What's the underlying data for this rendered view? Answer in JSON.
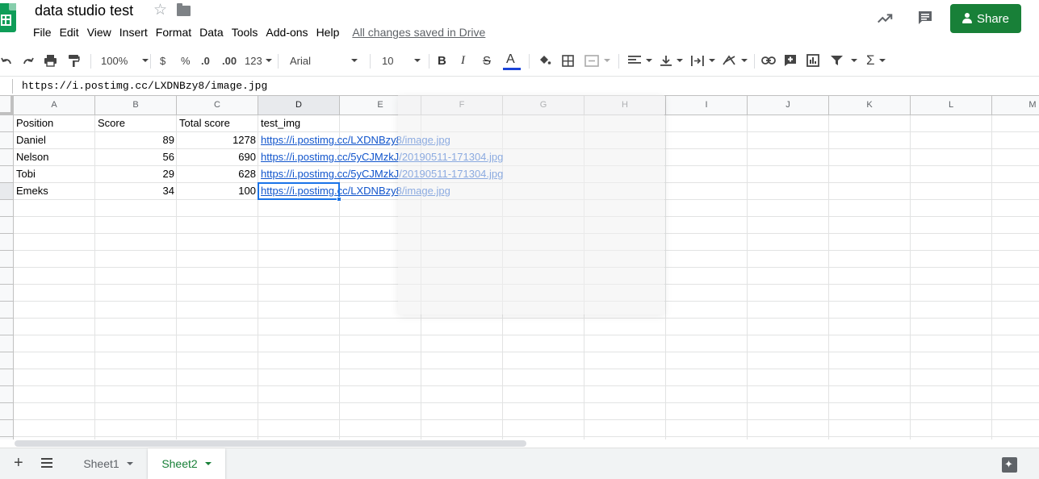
{
  "header": {
    "title": "data studio test",
    "menu": [
      "File",
      "Edit",
      "View",
      "Insert",
      "Format",
      "Data",
      "Tools",
      "Add-ons",
      "Help"
    ],
    "saved_note": "All changes saved in Drive",
    "share_label": "Share"
  },
  "toolbar": {
    "zoom": "100%",
    "currency": "$",
    "percent": "%",
    "decimal_decrease": ".0",
    "decimal_increase": ".00",
    "more_formats": "123",
    "font": "Arial",
    "font_size": "10",
    "bold": "B",
    "italic": "I",
    "strike": "S",
    "text_color": "A",
    "function_symbol": "Σ"
  },
  "formula_bar": {
    "value": "https://i.postimg.cc/LXDNBzy8/image.jpg"
  },
  "grid": {
    "columns": [
      "A",
      "B",
      "C",
      "D",
      "E",
      "F",
      "G",
      "H",
      "I",
      "J",
      "K",
      "L",
      "M"
    ],
    "selected_column": "D",
    "selected_row": 5,
    "headers": [
      "Position",
      "Score",
      "Total score",
      "test_img"
    ],
    "rows": [
      {
        "position": "Daniel",
        "score": "89",
        "total": "1278",
        "img": "https://i.postimg.cc/LXDNBzy8/image.jpg"
      },
      {
        "position": "Nelson",
        "score": "56",
        "total": "690",
        "img": "https://i.postimg.cc/5yCJMzkJ/20190511-171304.jpg"
      },
      {
        "position": "Tobi",
        "score": "29",
        "total": "628",
        "img": "https://i.postimg.cc/5yCJMzkJ/20190511-171304.jpg"
      },
      {
        "position": "Emeks",
        "score": "34",
        "total": "100",
        "img": "https://i.postimg.cc/LXDNBzy8/image.jpg"
      }
    ]
  },
  "sheets": {
    "tabs": [
      {
        "label": "Sheet1",
        "active": false
      },
      {
        "label": "Sheet2",
        "active": true
      }
    ]
  },
  "colors": {
    "accent": "#188038",
    "selection": "#1a73e8",
    "link": "#1155cc"
  }
}
